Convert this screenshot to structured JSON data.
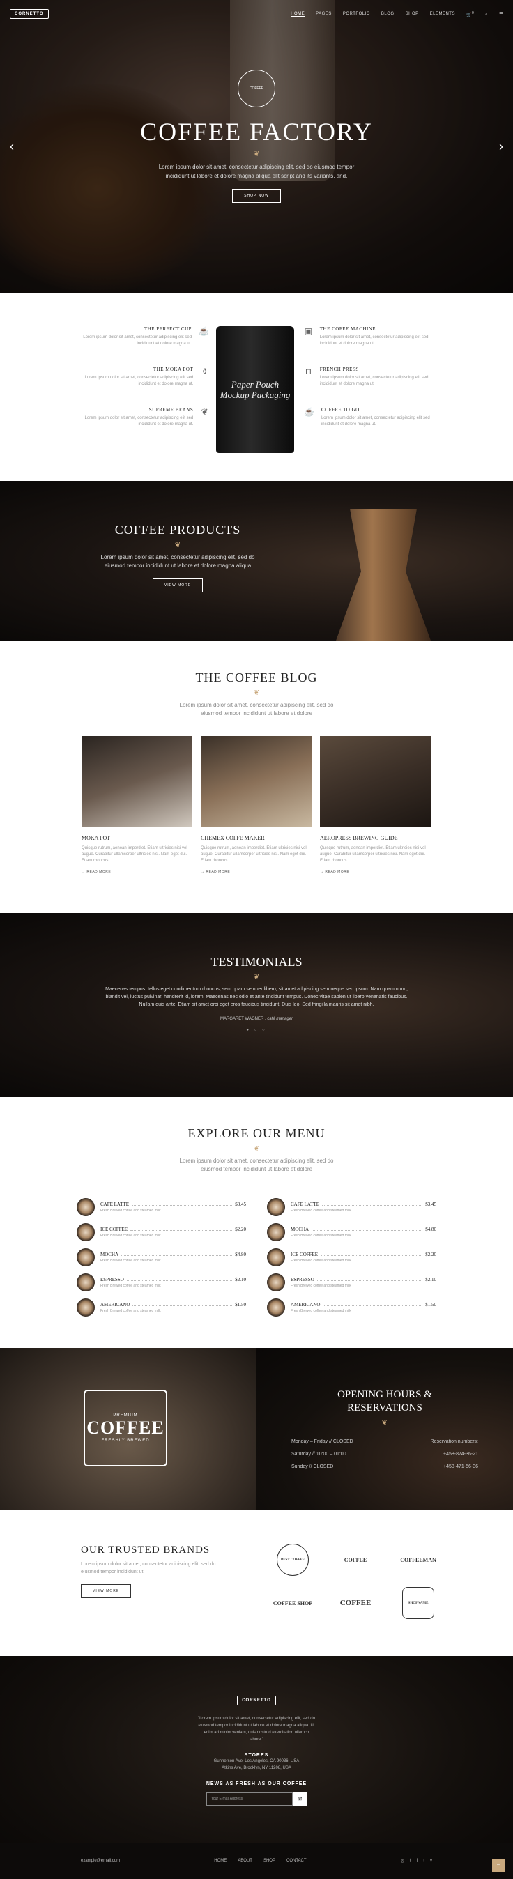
{
  "nav": {
    "logo": "CORNETTO",
    "items": [
      "HOME",
      "PAGES",
      "PORTFOLIO",
      "BLOG",
      "SHOP",
      "ELEMENTS"
    ],
    "cart_count": "0"
  },
  "hero": {
    "badge": "COFFEE",
    "title": "COFFEE FACTORY",
    "ornament": "❦",
    "text": "Lorem ipsum dolor sit amet, consectetur adipiscing elit, sed do eiusmod tempor incididunt ut labore et dolore magna aliqua elit script and its variants, and.",
    "button": "SHOP NOW"
  },
  "features": {
    "left": [
      {
        "title": "THE PERFECT CUP",
        "text": "Lorem ipsum dolor sit amet, consectetur adipiscing elit sed incididunt et dolore magna ut."
      },
      {
        "title": "THE MOKA POT",
        "text": "Lorem ipsum dolor sit amet, consectetur adipiscing elit sed incididunt et dolore magna ut."
      },
      {
        "title": "SUPREME BEANS",
        "text": "Lorem ipsum dolor sit amet, consectetur adipiscing elit sed incididunt et dolore magna ut."
      }
    ],
    "right": [
      {
        "title": "THE COFEE MACHINE",
        "text": "Lorem ipsum dolor sit amet, consectetur adipiscing elit sed incididunt et dolore magna ut."
      },
      {
        "title": "FRENCH PRESS",
        "text": "Lorem ipsum dolor sit amet, consectetur adipiscing elit sed incididunt et dolore magna ut."
      },
      {
        "title": "COFFEE TO GO",
        "text": "Lorem ipsum dolor sit amet, consectetur adipiscing elit sed incididunt et dolore magna ut."
      }
    ],
    "bag_text": "Paper Pouch Mockup Packaging"
  },
  "products": {
    "title": "COFFEE PRODUCTS",
    "text": "Lorem ipsum dolor sit amet, consectetur adipiscing elit, sed do eiusmod tempor incididunt ut labore et dolore magna aliqua",
    "button": "VIEW MORE"
  },
  "blog": {
    "title": "THE COFFEE BLOG",
    "text": "Lorem ipsum dolor sit amet, consectetur adipiscing elit, sed do eiusmod tempor incididunt ut labore et dolore",
    "posts": [
      {
        "title": "MOKA POT",
        "text": "Quisque rutrum, aenean imperdiet. Etiam ultricies nisi vel augue. Curabitur ullamcorper ultricies nisi. Nam eget dui. Etiam rhoncus.",
        "more": "READ MORE"
      },
      {
        "title": "CHEMEX COFFE MAKER",
        "text": "Quisque rutrum, aenean imperdiet. Etiam ultricies nisi vel augue. Curabitur ullamcorper ultricies nisi. Nam eget dui. Etiam rhoncus.",
        "more": "READ MORE"
      },
      {
        "title": "AEROPRESS BREWING GUIDE",
        "text": "Quisque rutrum, aenean imperdiet. Etiam ultricies nisi vel augue. Curabitur ullamcorper ultricies nisi. Nam eget dui. Etiam rhoncus.",
        "more": "READ MORE"
      }
    ]
  },
  "testimonials": {
    "title": "TESTIMONIALS",
    "text": "Maecenas tempus, tellus eget condimentum rhoncus, sem quam semper libero, sit amet adipiscing sem neque sed ipsum. Nam quam nunc, blandit vel, luctus pulvinar, hendrerit id, lorem. Maecenas nec odio et ante tincidunt tempus. Donec vitae sapien ut libero venenatis faucibus. Nullam quis ante. Etiam sit amet orci eget eros faucibus tincidunt. Duis leo. Sed fringilla mauris sit amet nibh.",
    "author": "MARGARET WAGNER",
    "role": "café manager"
  },
  "menu": {
    "title": "EXPLORE OUR MENU",
    "text": "Lorem ipsum dolor sit amet, consectetur adipiscing elit, sed do eiusmod tempor incididunt ut labore et dolore",
    "left": [
      {
        "name": "CAFE LATTE",
        "price": "$3.45",
        "desc": "Fresh Brewed coffee and steamed milk"
      },
      {
        "name": "ICE COFFEE",
        "price": "$2.20",
        "desc": "Fresh Brewed coffee and steamed milk"
      },
      {
        "name": "MOCHA",
        "price": "$4.80",
        "desc": "Fresh Brewed coffee and steamed milk"
      },
      {
        "name": "ESPRESSO",
        "price": "$2.10",
        "desc": "Fresh Brewed coffee and steamed milk"
      },
      {
        "name": "AMERICANO",
        "price": "$1.50",
        "desc": "Fresh Brewed coffee and steamed milk"
      }
    ],
    "right": [
      {
        "name": "CAFE LATTE",
        "price": "$3.45",
        "desc": "Fresh Brewed coffee and steamed milk"
      },
      {
        "name": "MOCHA",
        "price": "$4.80",
        "desc": "Fresh Brewed coffee and steamed milk"
      },
      {
        "name": "ICE COFFEE",
        "price": "$2.20",
        "desc": "Fresh Brewed coffee and steamed milk"
      },
      {
        "name": "ESPRESSO",
        "price": "$2.10",
        "desc": "Fresh Brewed coffee and steamed milk"
      },
      {
        "name": "AMERICANO",
        "price": "$1.50",
        "desc": "Fresh Brewed coffee and steamed milk"
      }
    ]
  },
  "hours": {
    "stamp_top": "PREMIUM",
    "stamp_main": "COFFEE",
    "stamp_bottom": "FRESHLY BREWED",
    "title_line1": "OPENING HOURS &",
    "title_line2": "RESERVATIONS",
    "rows": [
      {
        "left": "Monday – Friday // CLOSED",
        "right": "Reservation numbers:"
      },
      {
        "left": "Saturday // 10:00 – 01:00",
        "right": "+458-874-36-21"
      },
      {
        "left": "Sunday // CLOSED",
        "right": "+458-471-56-36"
      }
    ]
  },
  "brands": {
    "title": "OUR TRUSTED BRANDS",
    "text": "Lorem ipsum dolor sit amet, consectetur adipiscing elit, sed do eiusmod tempor incididunt ut",
    "button": "VIEW MORE",
    "logos": [
      "BEST COFFEE",
      "COFFEE",
      "COFFEEMAN",
      "COFFEE SHOP",
      "COFFEE",
      "SHOPNAME"
    ]
  },
  "footer": {
    "logo": "CORNETTO",
    "quote": "\"Lorem ipsum dolor sit amet, consectetur adipiscing elit, sed do eiusmod tempor incididunt ut labore et dolore magna aliqua. Ut enim ad minim veniam, quis nostrud exercitation ullamco labore.\"",
    "stores_title": "STORES",
    "addr1": "Gunnerson Ave, Los Angeles, CA 90036, USA",
    "addr2": "Atkins Ave, Brooklyn, NY 11208, USA",
    "news_title": "NEWS AS FRESH AS OUR COFFEE",
    "email_placeholder": "Your E-mail Address",
    "contact": "example@email.com",
    "menu": [
      "HOME",
      "ABOUT",
      "SHOP",
      "CONTACT"
    ]
  },
  "colors": {
    "accent": "#c9a97e",
    "dark": "#14100d"
  }
}
